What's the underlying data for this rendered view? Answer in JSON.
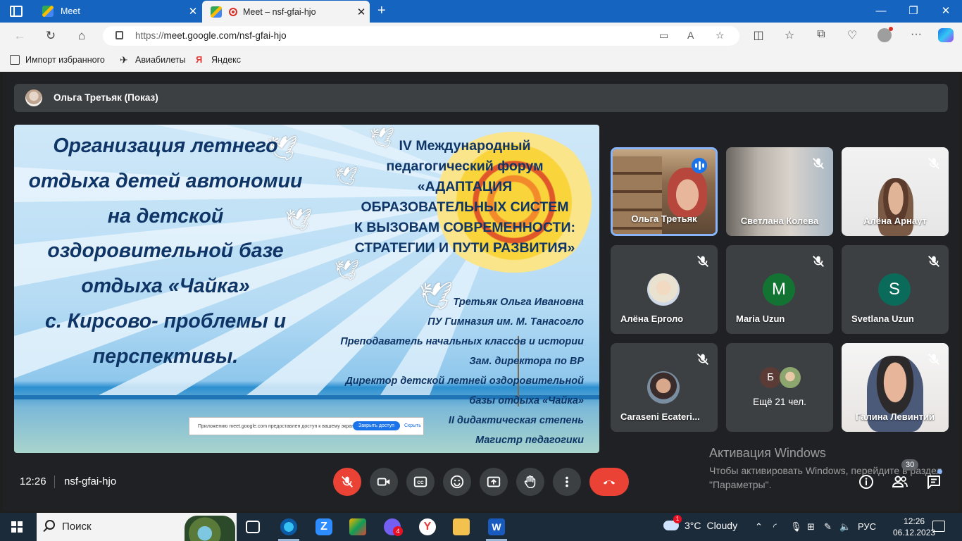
{
  "browser": {
    "tabs": [
      {
        "title": "Meet",
        "active": false
      },
      {
        "title": "Meet – nsf-gfai-hjo",
        "active": true
      }
    ],
    "url_scheme": "https://",
    "url_host": "meet.google.com/nsf-gfai-hjo",
    "favorites": [
      {
        "label": "Импорт избранного",
        "icon": "import-icon"
      },
      {
        "label": "Авиабилеты",
        "icon": "plane-icon"
      },
      {
        "label": "Яндекс",
        "icon": "yandex-icon"
      }
    ]
  },
  "meet": {
    "presenter_label": "Ольга Третьяк (Показ)",
    "slide": {
      "left_title_lines": [
        "Организация летнего",
        "отдыха детей автономии",
        "на детской",
        "оздоровительной базе",
        "отдыха «Чайка»",
        "с. Кирсово- проблемы и",
        "перспективы."
      ],
      "right_title_lines": [
        "IV Международный",
        "педагогический форум",
        "«АДАПТАЦИЯ",
        "ОБРАЗОВАТЕЛЬНЫХ СИСТЕМ",
        "К ВЫЗОВАМ СОВРЕМЕННОСТИ:",
        "СТРАТЕГИИ И ПУТИ РАЗВИТИЯ»"
      ],
      "author_lines": [
        "Третьяк Ольга Ивановна",
        "ПУ Гимназия им. М. Танасогло",
        "Преподаватель начальных классов и истории",
        "Зам. директора по ВР",
        "Директор детской летней оздоровительной",
        "базы отдыха «Чайка»",
        "II дидактическая степень",
        "Магистр педагогики"
      ],
      "share_notice": {
        "text": "Приложению meet.google.com предоставлен доступ к вашему экрану.",
        "stop_label": "Закрыть доступ",
        "hide_label": "Скрыть"
      }
    },
    "participants": [
      {
        "name": "Ольга Третьяк",
        "status": "speaking"
      },
      {
        "name": "Светлана Колева",
        "status": "muted"
      },
      {
        "name": "Алёна Арнаут",
        "status": "muted"
      },
      {
        "name": "Алёна Ерголо",
        "status": "muted"
      },
      {
        "name": "Maria Uzun",
        "status": "muted",
        "initial": "M",
        "color": "#137333"
      },
      {
        "name": "Svetlana Uzun",
        "status": "muted",
        "initial": "S",
        "color": "#0b6b5a"
      },
      {
        "name": "Caraseni Ecateri...",
        "status": "muted"
      },
      {
        "name": "Галина Левинтий",
        "status": "muted"
      }
    ],
    "more_participants": {
      "initial": "Б",
      "label": "Ещё 21 чел."
    },
    "time": "12:26",
    "meeting_code": "nsf-gfai-hjo",
    "participant_count": "30",
    "activation": {
      "title": "Активация Windows",
      "text": "Чтобы активировать Windows, перейдите в раздел \"Параметры\"."
    }
  },
  "taskbar": {
    "search_placeholder": "Поиск",
    "viber_badge": "4",
    "weather_temp": "3°C",
    "weather_text": "Cloudy",
    "weather_badge": "1",
    "language": "РУС",
    "clock_time": "12:26",
    "clock_date": "06.12.2023"
  }
}
